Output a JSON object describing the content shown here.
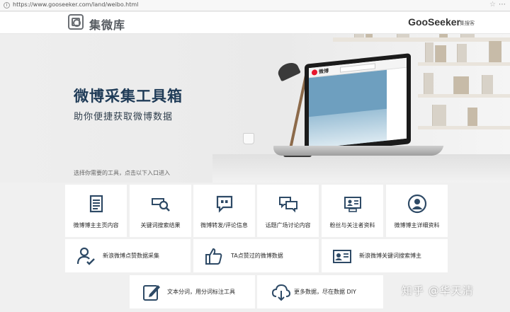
{
  "browser": {
    "url": "https://www.gooseeker.com/land/weibo.html"
  },
  "header": {
    "logo_text": "集微库",
    "brand_name": "GooSeeker",
    "brand_sub": "集搜客"
  },
  "hero": {
    "title": "微博采集工具箱",
    "subtitle": "助你便捷获取微博数据",
    "screen_app": "微博"
  },
  "prompt": "选择你需要的工具，点击以下入口进入",
  "tools": {
    "row1": [
      {
        "label": "微博博主主页内容",
        "icon": "document-lines-icon"
      },
      {
        "label": "关键词搜索结果",
        "icon": "magnifier-icon"
      },
      {
        "label": "微博转发/评论信息",
        "icon": "quote-bubble-icon"
      },
      {
        "label": "话题广场讨论内容",
        "icon": "chat-bubbles-icon"
      },
      {
        "label": "粉丝与关注者资料",
        "icon": "id-card-icon"
      },
      {
        "label": "微博博主详细资料",
        "icon": "user-circle-icon"
      }
    ],
    "row2": [
      {
        "label": "新浪微博点赞数据采集",
        "icon": "user-check-icon"
      },
      {
        "label": "TA点赞过的微博数据",
        "icon": "thumbs-up-icon"
      },
      {
        "label": "新浪微博关键词搜索博主",
        "icon": "contact-card-icon"
      }
    ],
    "row3": [
      {
        "label": "文本分词，用分词标注工具",
        "icon": "edit-icon"
      },
      {
        "label": "更多数据，尽在数据 DIY",
        "icon": "cloud-download-icon"
      }
    ]
  },
  "watermark": "知乎 @华天清",
  "colors": {
    "accent": "#2e4a66",
    "title": "#1f3b57",
    "weibo_red": "#e6162d"
  }
}
